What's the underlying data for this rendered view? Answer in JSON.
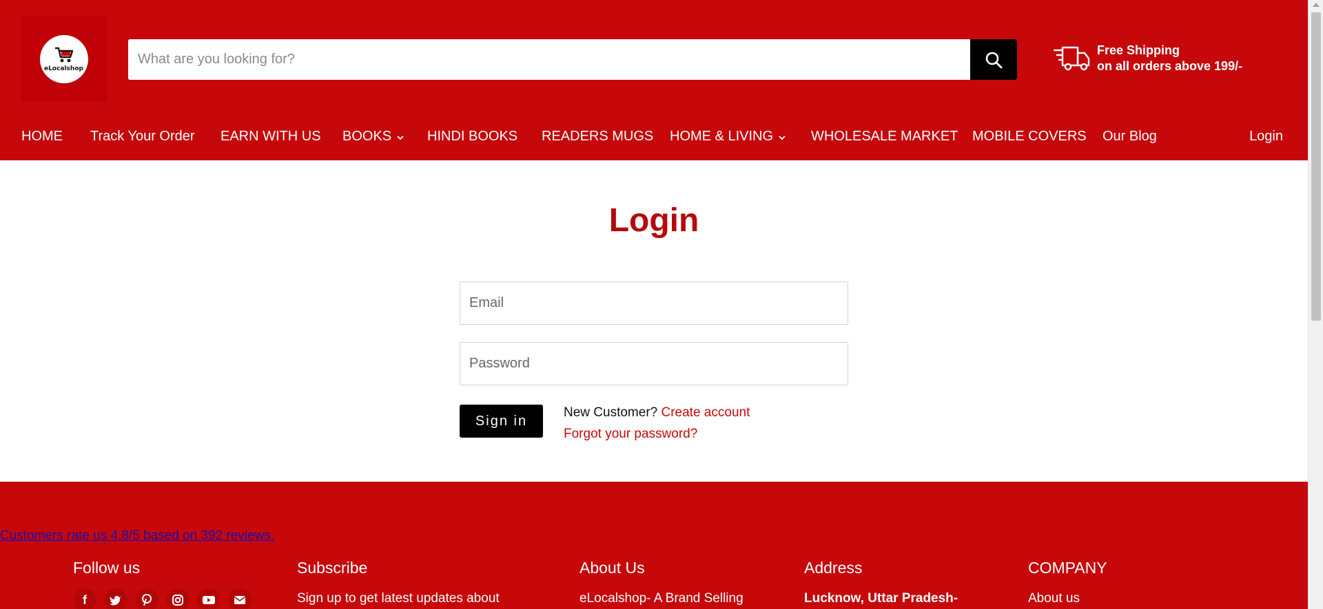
{
  "brand": {
    "logo_text": "eLocalshop"
  },
  "search": {
    "placeholder": "What are you looking for?"
  },
  "shipping": {
    "line1": "Free Shipping",
    "line2": "on all orders above 199/-"
  },
  "nav": {
    "items": [
      {
        "label": "HOME",
        "dropdown": false
      },
      {
        "label": "Track Your Order",
        "dropdown": false
      },
      {
        "label": "EARN WITH US",
        "dropdown": false
      },
      {
        "label": "BOOKS",
        "dropdown": true
      },
      {
        "label": "HINDI BOOKS",
        "dropdown": false
      },
      {
        "label": "READERS MUGS",
        "dropdown": false
      },
      {
        "label": "HOME & LIVING",
        "dropdown": true
      },
      {
        "label": "WHOLESALE MARKET",
        "dropdown": false
      },
      {
        "label": "MOBILE COVERS",
        "dropdown": false
      },
      {
        "label": "Our Blog",
        "dropdown": false
      }
    ],
    "login": "Login"
  },
  "login_form": {
    "title": "Login",
    "email_placeholder": "Email",
    "password_placeholder": "Password",
    "signin_label": "Sign in",
    "new_customer": "New Customer?",
    "create_account": "Create account",
    "forgot_password": "Forgot your password?"
  },
  "footer": {
    "rating_text": "Customers rate us 4.8/5 based on 392 reviews.",
    "follow": {
      "heading": "Follow us",
      "icons": [
        "facebook-icon",
        "twitter-icon",
        "pinterest-icon",
        "instagram-icon",
        "youtube-icon",
        "email-icon"
      ]
    },
    "subscribe": {
      "heading": "Subscribe",
      "text": "Sign up to get latest updates about"
    },
    "about": {
      "heading": "About Us",
      "text": "eLocalshop- A Brand Selling"
    },
    "address": {
      "heading": "Address",
      "text": "Lucknow, Uttar Pradesh-"
    },
    "company": {
      "heading": "COMPANY",
      "text": "About us"
    }
  },
  "colors": {
    "brand_red": "#c6080b",
    "title_red": "#b5090b",
    "black": "#000000",
    "white": "#ffffff",
    "link_blue": "#1a0dab"
  }
}
